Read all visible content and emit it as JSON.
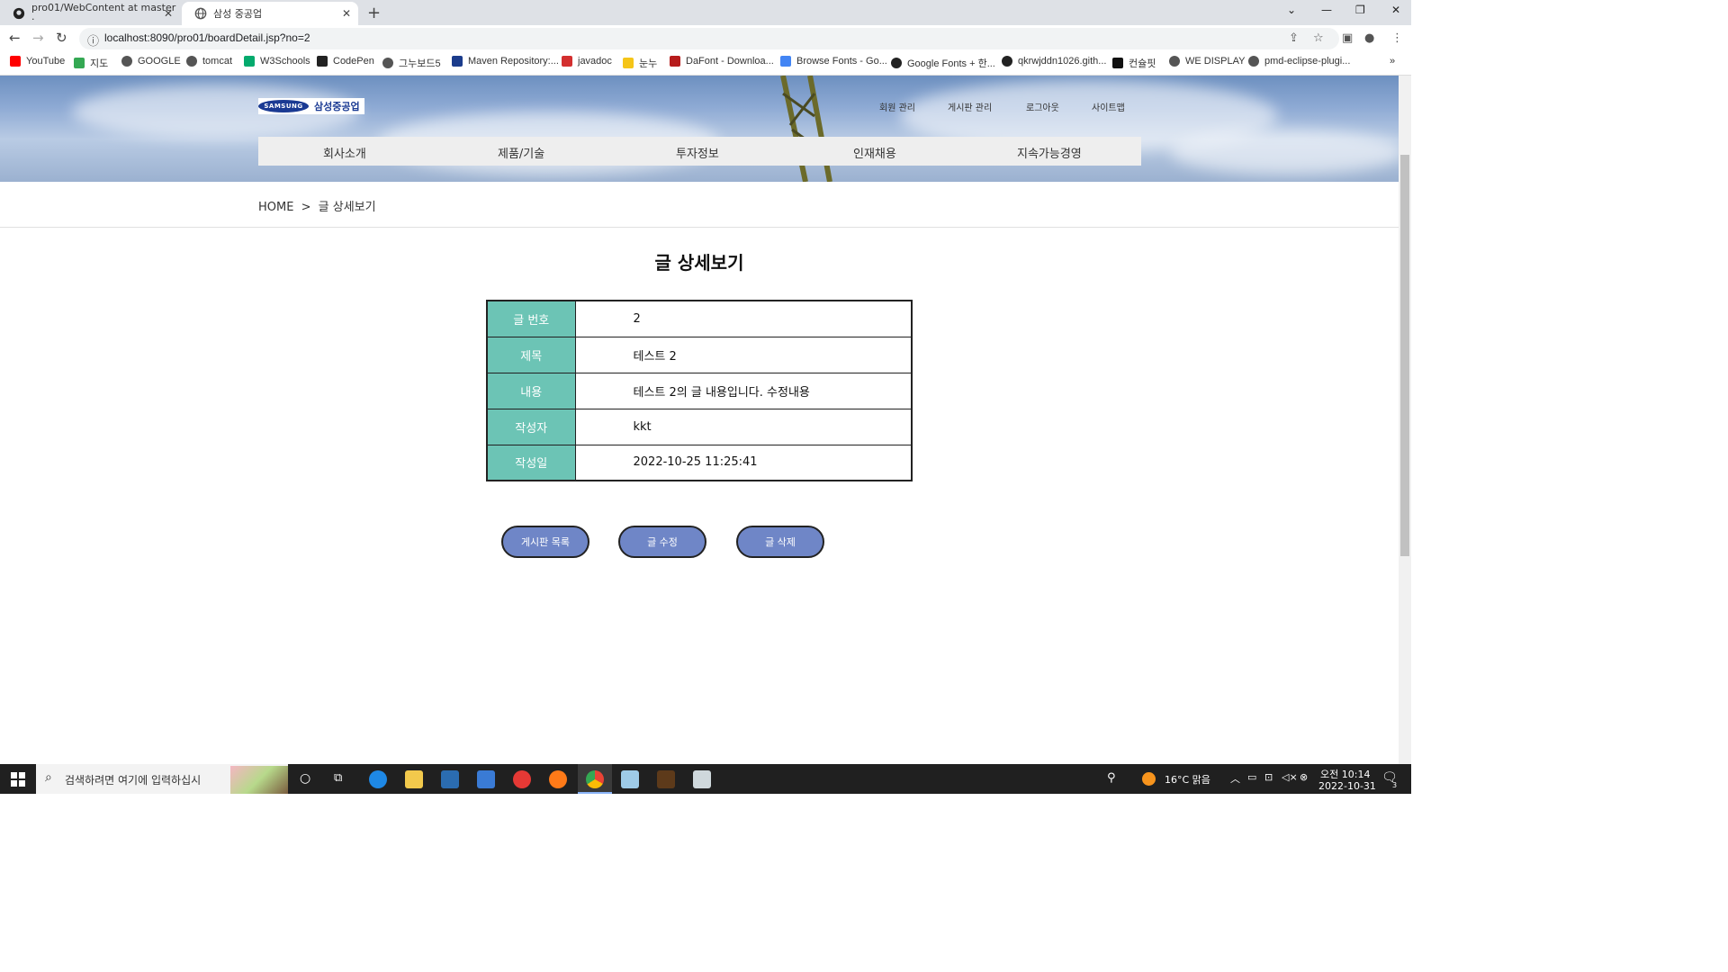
{
  "browser": {
    "tabs": [
      {
        "title": "pro01/WebContent at master · ",
        "active": false
      },
      {
        "title": "삼성 중공업",
        "active": true
      }
    ],
    "url": "localhost:8090/pro01/boardDetail.jsp?no=2",
    "bookmarks": [
      {
        "label": "YouTube",
        "color": "#ff0000"
      },
      {
        "label": "지도",
        "color": "#34a853"
      },
      {
        "label": "GOOGLE",
        "color": "#555555"
      },
      {
        "label": "tomcat",
        "color": "#555555"
      },
      {
        "label": "W3Schools",
        "color": "#04aa6d"
      },
      {
        "label": "CodePen",
        "color": "#222222"
      },
      {
        "label": "그누보드5",
        "color": "#555555"
      },
      {
        "label": "Maven Repository:...",
        "color": "#1b3c8c"
      },
      {
        "label": "javadoc",
        "color": "#d32f2f"
      },
      {
        "label": "눈누",
        "color": "#f5c518"
      },
      {
        "label": "DaFont - Downloa...",
        "color": "#b71c1c"
      },
      {
        "label": "Browse Fonts - Go...",
        "color": "#4285f4"
      },
      {
        "label": "Google Fonts + 한...",
        "color": "#222222"
      },
      {
        "label": "qkrwjddn1026.gith...",
        "color": "#222222"
      },
      {
        "label": "컨슐핏",
        "color": "#111111"
      },
      {
        "label": "WE DISPLAY",
        "color": "#555555"
      },
      {
        "label": "pmd-eclipse-plugi...",
        "color": "#555555"
      }
    ]
  },
  "site": {
    "logo_mark": "SAMSUNG",
    "logo_text": "삼성중공업",
    "top_links": [
      "회원 관리",
      "게시판 관리",
      "로그아웃",
      "사이트맵"
    ],
    "gnb": [
      "회사소개",
      "제품/기술",
      "투자정보",
      "인재채용",
      "지속가능경영"
    ],
    "breadcrumb": {
      "home": "HOME",
      "sep": ">",
      "current": "글 상세보기"
    },
    "title": "글 상세보기",
    "detail": [
      {
        "label": "글 번호",
        "value": "2"
      },
      {
        "label": "제목",
        "value": "테스트 2"
      },
      {
        "label": "내용",
        "value": "테스트 2의 글 내용입니다. 수정내용"
      },
      {
        "label": "작성자",
        "value": "kkt"
      },
      {
        "label": "작성일",
        "value": "2022-10-25 11:25:41"
      }
    ],
    "buttons": {
      "list": "게시판 목록",
      "edit": "글 수정",
      "delete": "글 삭제"
    }
  },
  "taskbar": {
    "search_placeholder": "검색하려면 여기에 입력하십시",
    "weather": "16°C 맑음",
    "time": "오전 10:14",
    "date": "2022-10-31",
    "notifications": "3"
  },
  "colors": {
    "accent_teal": "#6cc4b5",
    "button_blue": "#6f86c7"
  }
}
